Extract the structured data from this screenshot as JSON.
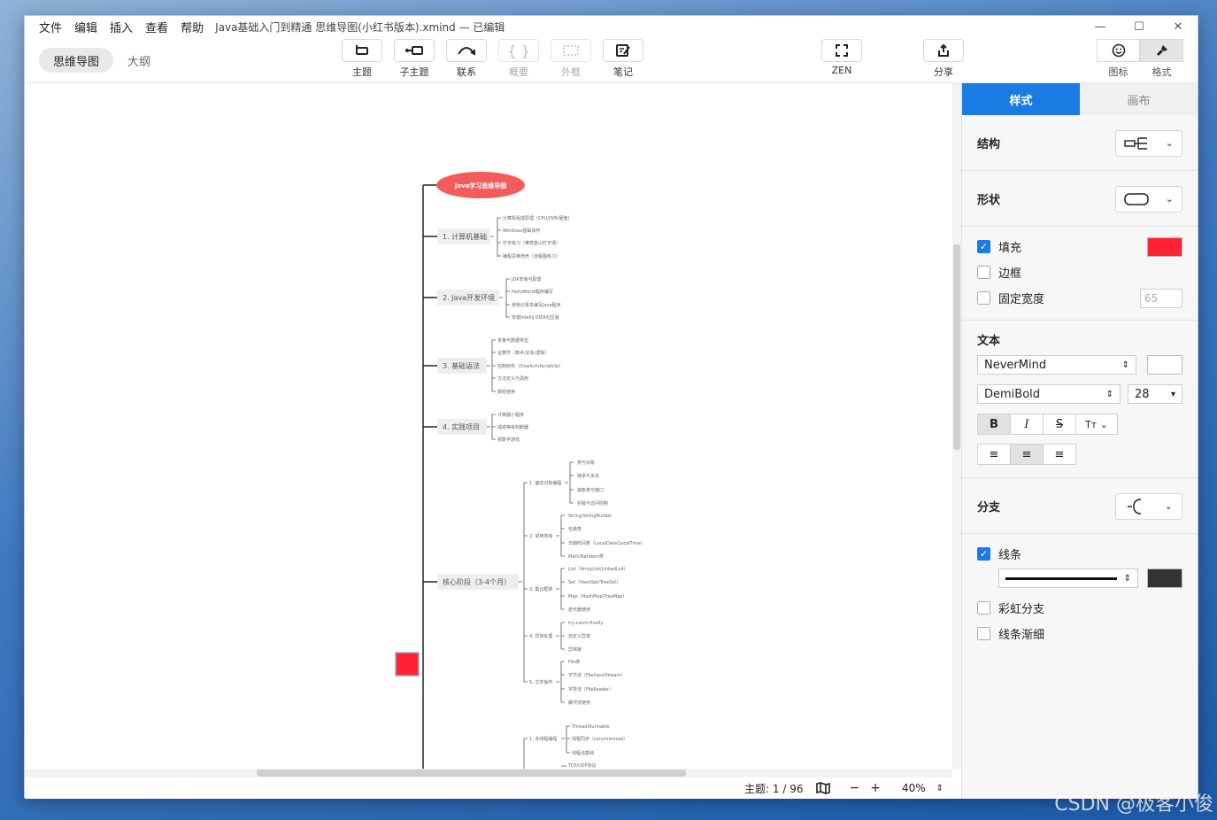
{
  "menu": [
    "文件",
    "编辑",
    "插入",
    "查看",
    "帮助"
  ],
  "doc_title": "Java基础入门到精通 思维导图(小红书版本).xmind — 已编辑",
  "window_controls": [
    "—",
    "☐",
    "✕"
  ],
  "view_toggle": {
    "mindmap": "思维导图",
    "outline": "大纲"
  },
  "tools": {
    "topic": "主题",
    "subtopic": "子主题",
    "relation": "联系",
    "summary": "概要",
    "boundary": "外框",
    "note": "笔记",
    "zen": "ZEN",
    "share": "分享"
  },
  "right_toggle": {
    "icon": "图标",
    "format": "格式"
  },
  "panel": {
    "tabs": {
      "style": "样式",
      "canvas": "画布"
    },
    "structure": "结构",
    "shape": "形状",
    "fill": "填充",
    "fill_color": "#ff2233",
    "border": "边框",
    "fixed_width": "固定宽度",
    "fixed_width_value": "65",
    "text": "文本",
    "font": "NeverMind",
    "weight": "DemiBold",
    "size": "28",
    "branch": "分支",
    "line": "线条",
    "line_color": "#333333",
    "rainbow": "彩虹分支",
    "taper": "线条渐细"
  },
  "status": {
    "topics": "主题: 1 / 96",
    "zoom": "40%"
  },
  "mindmap": {
    "root": "Java学习思维导图",
    "branches": [
      {
        "label": "1. 计算机基础",
        "children": [
          "计算机组成原理（CPU/内存/硬盘）",
          "Windows基础操作",
          "打字练习（推荐金山打字通）",
          "编程思维培养（流程图练习）"
        ]
      },
      {
        "label": "2. Java开发环境",
        "children": [
          "JDK安装与配置",
          "HelloWorld程序编写",
          "使用记事本编写Java程序",
          "安装IntelliJ IDEA社区版"
        ]
      },
      {
        "label": "3. 基础语法",
        "children": [
          "变量与数据类型",
          "运算符（算术/关系/逻辑）",
          "控制结构（if/switch/for/while）",
          "方法定义与调用",
          "数组使用"
        ]
      },
      {
        "label": "4. 实践项目",
        "children": [
          "计算器小程序",
          "成绩等级判断器",
          "猜数字游戏"
        ]
      },
      {
        "label": "核心阶段（3-4个月）",
        "subs": [
          {
            "label": "1. 面向对象编程",
            "children": [
              "类与对象",
              "继承与多态",
              "抽象类与接口",
              "封装与访问控制"
            ]
          },
          {
            "label": "2. 常用类库",
            "children": [
              "String/StringBuilder",
              "包装类",
              "日期时间类（LocalDate/LocalTime）",
              "Math/Random类"
            ]
          },
          {
            "label": "3. 集合框架",
            "children": [
              "List（ArrayList/LinkedList）",
              "Set（HashSet/TreeSet）",
              "Map（HashMap/TreeMap）",
              "迭代器使用"
            ]
          },
          {
            "label": "4. 异常处理",
            "children": [
              "try-catch-finally",
              "自定义异常",
              "异常链"
            ]
          },
          {
            "label": "5. 文件操作",
            "children": [
              "File类",
              "字节流（FileInputStream）",
              "字符流（FileReader）",
              "缓冲流使用"
            ]
          }
        ]
      },
      {
        "label": "",
        "subs": [
          {
            "label": "1. 多线程编程",
            "children": [
              "Thread/Runnable",
              "线程同步（synchronized）",
              "线程池基础"
            ]
          },
          {
            "label": "",
            "children": [
              "TCP/UDP协议"
            ]
          }
        ]
      }
    ]
  },
  "watermark": "CSDN @极客小俊"
}
